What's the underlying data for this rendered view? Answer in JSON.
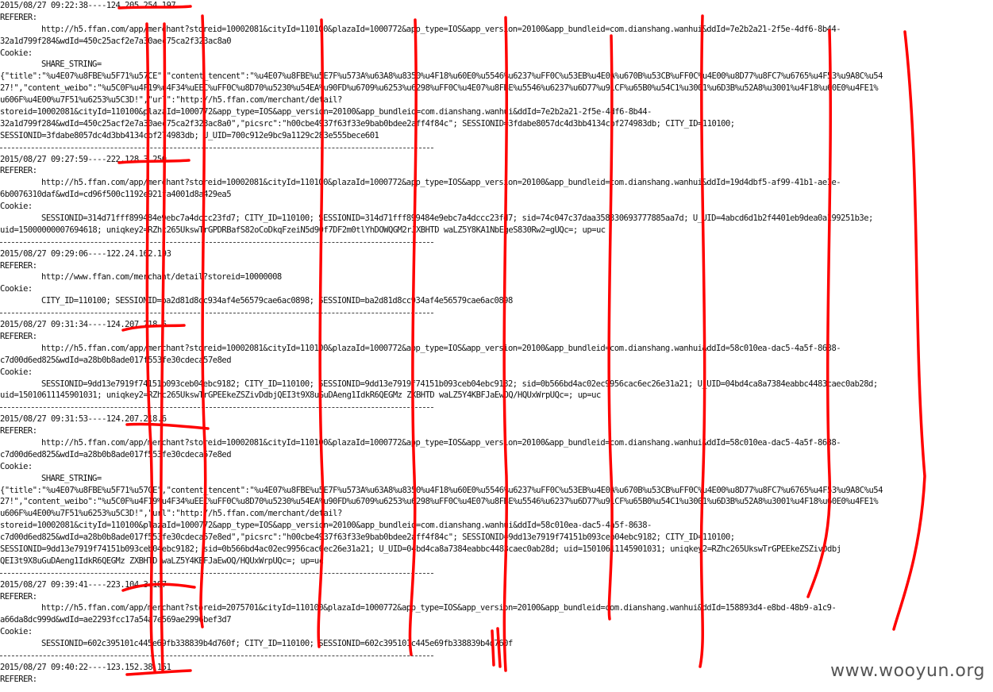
{
  "watermark": "www.wooyun.org",
  "annotation_color": "#ff0000",
  "separator": "------------------------------------------------------------------------------------------",
  "log_lines": [
    {
      "t": "2015/08/27 09:22:38----124.205.254.197",
      "k": "ts"
    },
    {
      "t": "REFERER:",
      "k": "h"
    },
    {
      "t": "http://h5.ffan.com/app/merchant?storeid=10002081&cityId=110100&plazaId=1000772&app_type=IOS&app_version=20100&app_bundleid=com.dianshang.wanhui&ddId=7e2b2a21-2f5e-4df6-8b44-",
      "k": "i"
    },
    {
      "t": "32a1d799f284&wdId=450c25acf2e7a30aec75ca2f323ac8a0",
      "k": "c"
    },
    {
      "t": "Cookie:",
      "k": "h"
    },
    {
      "t": "SHARE_STRING=",
      "k": "i"
    },
    {
      "t": "{\"title\":\"%u4E07%u8FBE%u5F71%u57CE\",\"content_tencent\":\"%u4E07%u8FBE%u5E7F%u573A%u63A8%u8350%u4F18%u60E0%u5546%u6237%uFF0C%u53EB%u4E0A%u670B%u53CB%uFF0C%u4E00%u8D77%u8FC7%u6765%u4F53%u9A8C%u54",
      "k": "c"
    },
    {
      "t": "27!\",\"content_weibo\":\"%u5C0F%u4F19%u4F34%uEEC%uFF0C%u8D70%u5230%u54EA%u90FD%u6709%u6253%u6298%uFF0C%u4E07%u8FBE%u5546%u6237%u6D77%u91CF%u65B0%u54C1%u3001%u6D3B%u52A8%u3001%u4F18%u60E0%u4FE1%",
      "k": "c"
    },
    {
      "t": "u606F%u4E00%u7F51%u6253%u5C3D!\",\"url\":\"http://h5.ffan.com/merchant/detail?",
      "k": "c"
    },
    {
      "t": "storeid=10002081&cityId=110100&plazaId=1000772&app_type=IOS&app_version=20100&app_bundleid=com.dianshang.wanhui&ddId=7e2b2a21-2f5e-4df6-8b44-",
      "k": "c"
    },
    {
      "t": "32a1d799f284&wdId=450c25acf2e7a30aec75ca2f323ac8a0\",\"picsrc\":\"h00cbe4937f63f33e9bab0bdee2aff4f84c\"; SESSIONID=3fdabe8057dc4d3bb4134cbf274983db; CITY_ID=110100;",
      "k": "c"
    },
    {
      "t": "SESSIONID=3fdabe8057dc4d3bb4134cbf274983db; U_UID=700c912e9bc9a1129c283e555bece601",
      "k": "c"
    },
    {
      "t": "",
      "k": "sep"
    },
    {
      "t": "2015/08/27 09:27:59----222.128.3.250",
      "k": "ts"
    },
    {
      "t": "REFERER:",
      "k": "h"
    },
    {
      "t": "http://h5.ffan.com/app/merchant?storeid=10002081&cityId=110100&plazaId=1000772&app_type=IOS&app_version=20100&app_bundleid=com.dianshang.wanhui&ddId=19d4dbf5-af99-41b1-ae1e-",
      "k": "i"
    },
    {
      "t": "6b0076310daf&wdId=cd96f500c1192e921fa4001d8a429ea5",
      "k": "c"
    },
    {
      "t": "Cookie:",
      "k": "h"
    },
    {
      "t": "SESSIONID=314d71fff899484e9ebc7a4dccc23fd7; CITY_ID=110100; SESSIONID=314d71fff899484e9ebc7a4dccc23fd7; sid=74c047c37daa358330693777885aa7d; U_UID=4abcd6d1b2f4401eb9dea0a199251b3e;",
      "k": "i"
    },
    {
      "t": "uid=15000000007694618; uniqkey2=RZhc265UkswTrGPDRBafS82oCoDkqFzeiN5d90f7DF2m0tlYhDOWQGM2rJXBHTD waLZ5Y8KA1NbEgeS830Rw2=gUQc=; up=uc",
      "k": "c"
    },
    {
      "t": "",
      "k": "sep"
    },
    {
      "t": "2015/08/27 09:29:06----122.24.162.193",
      "k": "ts"
    },
    {
      "t": "REFERER:",
      "k": "h"
    },
    {
      "t": "http://www.ffan.com/merchant/detail?storeid=10000008",
      "k": "i"
    },
    {
      "t": "Cookie:",
      "k": "h"
    },
    {
      "t": "CITY_ID=110100; SESSIONID=ba2d81d8cc934af4e56579cae6ac0898; SESSIONID=ba2d81d8cc934af4e56579cae6ac0898",
      "k": "i"
    },
    {
      "t": "",
      "k": "sep"
    },
    {
      "t": "2015/08/27 09:31:34----124.207.218.6",
      "k": "ts"
    },
    {
      "t": "REFERER:",
      "k": "h"
    },
    {
      "t": "http://h5.ffan.com/app/merchant?storeid=10002081&cityId=110100&plazaId=1000772&app_type=IOS&app_version=20100&app_bundleid=com.dianshang.wanhui&ddId=58c010ea-dac5-4a5f-8638-",
      "k": "i"
    },
    {
      "t": "c7d00d6ed825&wdId=a28b0b8ade017f553fe30cdeca57e8ed",
      "k": "c"
    },
    {
      "t": "Cookie:",
      "k": "h"
    },
    {
      "t": "SESSIONID=9dd13e7919f74151b093ceb04ebc9182; CITY_ID=110100; SESSIONID=9dd13e7919f74151b093ceb04ebc9182; sid=0b566bd4ac02ec9956cac6ec26e31a21; U_UID=04bd4ca8a7384eabbc4483caec0ab28d;",
      "k": "i"
    },
    {
      "t": "uid=15010611145901031; uniqkey2=RZhc265UkswTrGPEEkeZSZivDdbjQEI3t9X8uGuDAeng1IdkR6QEGMz ZXBHTD waLZ5Y4KBFJaEwOQ/HQUxWrpUQc=; up=uc",
      "k": "c"
    },
    {
      "t": "",
      "k": "sep"
    },
    {
      "t": "2015/08/27 09:31:53----124.207.218.6",
      "k": "ts"
    },
    {
      "t": "REFERER:",
      "k": "h"
    },
    {
      "t": "http://h5.ffan.com/app/merchant?storeid=10002081&cityId=110100&plazaId=1000772&app_type=IOS&app_version=20100&app_bundleid=com.dianshang.wanhui&ddId=58c010ea-dac5-4a5f-8638-",
      "k": "i"
    },
    {
      "t": "c7d00d6ed825&wdId=a28b0b8ade017f553fe30cdeca57e8ed",
      "k": "c"
    },
    {
      "t": "Cookie:",
      "k": "h"
    },
    {
      "t": "SHARE_STRING=",
      "k": "i"
    },
    {
      "t": "{\"title\":\"%u4E07%u8FBE%u5F71%u57CE\",\"content_tencent\":\"%u4E07%u8FBE%u5E7F%u573A%u63A8%u8350%u4F18%u60E0%u5546%u6237%uFF0C%u53EB%u4E0A%u670B%u53CB%uFF0C%u4E00%u8D77%u8FC7%u6765%u4F53%u9A8C%u54",
      "k": "c"
    },
    {
      "t": "27!\",\"content_weibo\":\"%u5C0F%u4F19%u4F34%uEEC%uFF0C%u8D70%u5230%u54EA%u90FD%u6709%u6253%u6298%uFF0C%u4E07%u8FBE%u5546%u6237%u6D77%u91CF%u65B0%u54C1%u3001%u6D3B%u52A8%u3001%u4F18%u60E0%u4FE1%",
      "k": "c"
    },
    {
      "t": "u606F%u4E00%u7F51%u6253%u5C3D!\",\"url\":\"http://h5.ffan.com/merchant/detail?",
      "k": "c"
    },
    {
      "t": "storeid=10002081&cityId=110100&plazaId=1000772&app_type=IOS&app_version=20100&app_bundleid=com.dianshang.wanhui&ddId=58c010ea-dac5-4a5f-8638-",
      "k": "c"
    },
    {
      "t": "c7d00d6ed825&wdId=a28b0b8ade017f553fe30cdeca57e8ed\",\"picsrc\":\"h00cbe4937f63f33e9bab0bdee2aff4f84c\"; SESSIONID=9dd13e7919f74151b093ceb04ebc9182; CITY_ID=110100;",
      "k": "c"
    },
    {
      "t": "SESSIONID=9dd13e7919f74151b093ceb04ebc9182; sid=0b566bd4ac02ec9956cac6ec26e31a21; U_UID=04bd4ca8a7384eabbc4483caec0ab28d; uid=15010611145901031; uniqkey2=RZhc265UkswTrGPEEkeZSZivDdbj",
      "k": "c"
    },
    {
      "t": "QEI3t9X8uGuDAeng1IdkR6QEGMz ZXBHTD waLZ5Y4KBFJaEwOQ/HQUxWrpUQc=; up=uc",
      "k": "c"
    },
    {
      "t": "",
      "k": "sep"
    },
    {
      "t": "2015/08/27 09:39:41----223.104.3.187",
      "k": "ts"
    },
    {
      "t": "REFERER:",
      "k": "h"
    },
    {
      "t": "http://h5.ffan.com/app/merchant?storeid=2075701&cityId=110100&plazaId=1000772&app_type=IOS&app_version=20100&app_bundleid=com.dianshang.wanhui&ddId=158893d4-e8bd-48b9-a1c9-",
      "k": "i"
    },
    {
      "t": "a66da8dc999d&wdId=ae2293fcc17a54a7e569ae2996bef3d7",
      "k": "c"
    },
    {
      "t": "Cookie:",
      "k": "h"
    },
    {
      "t": "SESSIONID=602c395101c445e69fb338839b4d760f; CITY_ID=110100; SESSIONID=602c395101c445e69fb338839b4d760f",
      "k": "i"
    },
    {
      "t": "",
      "k": "sep"
    },
    {
      "t": "2015/08/27 09:40:22----123.152.38.151",
      "k": "ts"
    },
    {
      "t": "REFERER:",
      "k": "h"
    }
  ]
}
